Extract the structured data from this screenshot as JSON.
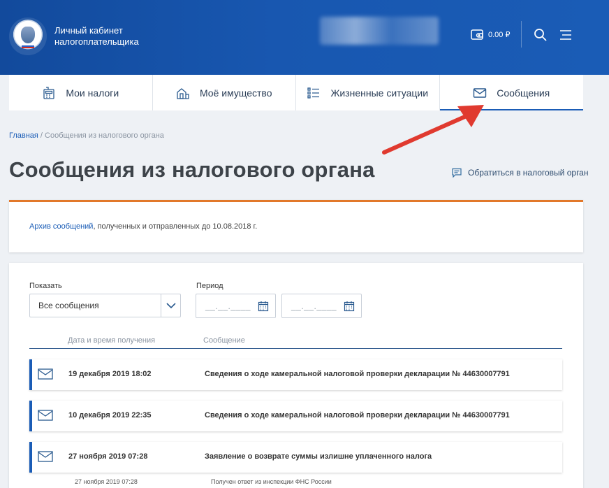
{
  "header": {
    "brand_line1": "Личный кабинет",
    "brand_line2": "налогоплательщика",
    "balance": "0.00 ₽"
  },
  "icons": {
    "logo": "fns-emblem-logo",
    "wallet": "wallet-icon",
    "search": "search-icon",
    "menu": "menu-icon",
    "mail": "envelope-icon",
    "calendar": "calendar-icon",
    "chat": "chat-bubble-icon"
  },
  "nav": {
    "tabs": [
      {
        "label": "Мои налоги",
        "icon": "calculator-icon"
      },
      {
        "label": "Моё имущество",
        "icon": "property-icon"
      },
      {
        "label": "Жизненные ситуации",
        "icon": "list-icon"
      },
      {
        "label": "Сообщения",
        "icon": "envelope-icon"
      }
    ],
    "active_index": 3
  },
  "breadcrumb": {
    "home": "Главная",
    "separator": " / ",
    "current": "Сообщения из налогового органа"
  },
  "page": {
    "title": "Сообщения из налогового органа",
    "contact_link": "Обратиться в налоговый орган"
  },
  "archive": {
    "link": "Архив сообщений",
    "text": ", полученных и отправленных до 10.08.2018 г."
  },
  "filters": {
    "show_label": "Показать",
    "show_value": "Все сообщения",
    "period_label": "Период",
    "date_placeholder": "__.__.____"
  },
  "table": {
    "col_date": "Дата и время получения",
    "col_message": "Сообщение",
    "rows": [
      {
        "date": "19 декабря 2019 18:02",
        "message": "Сведения о ходе камеральной налоговой проверки декларации № 44630007791"
      },
      {
        "date": "10 декабря 2019 22:35",
        "message": "Сведения о ходе камеральной налоговой проверки декларации № 44630007791"
      },
      {
        "date": "27 ноября 2019 07:28",
        "message": "Заявление о возврате суммы излишне уплаченного налога"
      }
    ],
    "sub_row": {
      "date": "27 ноября 2019 07:28",
      "message": "Получен ответ из инспекции ФНС России"
    }
  },
  "colors": {
    "header_blue": "#1857b0",
    "accent_blue": "#1a5cb6",
    "archive_orange": "#e2782a",
    "annotation_red": "#e03a2f"
  }
}
